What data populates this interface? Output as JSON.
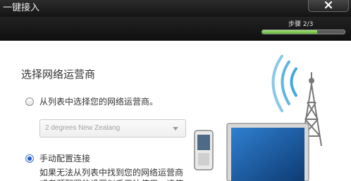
{
  "window": {
    "title": "一键接入",
    "close_icon": "close-icon"
  },
  "header": {
    "step_label": "步骤 2/3",
    "progress": {
      "current": 2,
      "total": 3,
      "fill_color": "#7ccc4f"
    }
  },
  "main": {
    "section_title": "选择网络运营商",
    "options": [
      {
        "label": "从列表中选择您的网络运营商。",
        "selected": false
      },
      {
        "label": "手动配置连接",
        "selected": true
      }
    ],
    "carrier_select": {
      "value": "2 degrees New Zealang",
      "icon": "chevron-down-icon"
    },
    "manual_description": "如果无法从列表中找到您的网络运营商或者预配置的设置似乎无法使用，请使"
  },
  "colors": {
    "accent": "#1a5ad1",
    "titlebar": "#1c1c1c",
    "signal_wave": "#3aa4d8"
  }
}
